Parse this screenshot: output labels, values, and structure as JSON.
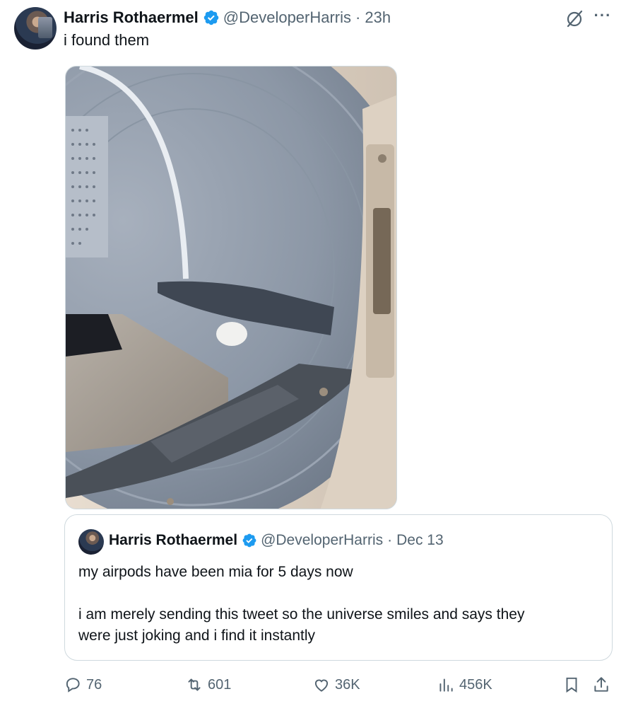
{
  "tweet": {
    "author_name": "Harris Rothaermel",
    "handle": "@DeveloperHarris",
    "separator": "·",
    "time": "23h",
    "text": "i found them",
    "icons": {
      "avatar": "user-avatar",
      "verified": "verified-badge-icon",
      "grok": "grok-icon",
      "more": "more-options-icon"
    },
    "more_label": "···"
  },
  "quote": {
    "author_name": "Harris Rothaermel",
    "handle": "@DeveloperHarris",
    "separator": "·",
    "date": "Dec 13",
    "line1": "my airpods have been mia for 5 days now",
    "line2": "i am merely sending this tweet so the universe smiles and says they",
    "line3": "were just joking and i find it instantly"
  },
  "actions": {
    "replies": "76",
    "reposts": "601",
    "likes": "36K",
    "views": "456K"
  },
  "colors": {
    "text": "#0f1419",
    "secondary": "#536471",
    "verified": "#1d9bf0",
    "border": "#cfd9de"
  }
}
